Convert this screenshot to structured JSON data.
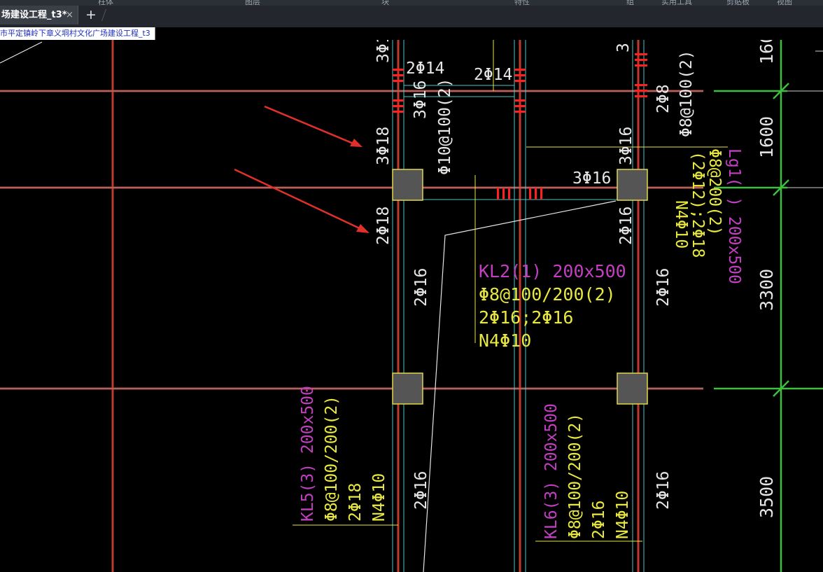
{
  "menu": {
    "items": [
      "柱体",
      "图层",
      "块",
      "特性",
      "组",
      "实用工具",
      "剪贴板",
      "视图"
    ]
  },
  "tabs": {
    "active_label": "场建设工程_t3*",
    "close_glyph": "×",
    "add_glyph": "+"
  },
  "filepath": "市平定镇岭下章义垌村文化广场建设工程_t3",
  "colors": {
    "axis_red": "#c0392b",
    "beam_cyan": "#4fc6c6",
    "rebar_white": "#e6e6e6",
    "beam_label_magenta": "#c040c0",
    "rebar_yellow": "#e8e840",
    "column_fill": "#555555",
    "column_border": "#e0d84a",
    "dim_green": "#3fbf3f",
    "arrow_red": "#e0302a"
  },
  "drawing": {
    "rebar_texts": {
      "col_left_top_cut": "3Φ1",
      "col_left_mid_top": "3Φ18",
      "col_left_mid_bottom": "2Φ18",
      "col_left_lower": "2Φ16",
      "col_left_bottom": "2Φ16",
      "beam_top_left": "2Φ14",
      "beam_top_right": "2Φ14",
      "beam_3Φ16_vertical": "3Φ16",
      "stirrup_vertical": "Φ10@100(2)",
      "col_right_top_cut": "3",
      "col_right_2Φ8": "2Φ8",
      "col_right_stirrup": "Φ8@100(2)",
      "col_right_3Φ16": "3Φ16",
      "beam_mid_3Φ16": "3Φ16",
      "col_right_2Φ16": "2Φ16",
      "col_right_lower": "2Φ16",
      "col_right_bottom": "2Φ16"
    },
    "kl2": {
      "title": "KL2(1) 200x500",
      "stirrup": "Φ8@100/200(2)",
      "bars": "2Φ16;2Φ16",
      "waist": "N4Φ10"
    },
    "lg1": {
      "title": "Lg1( ) 200x500",
      "stirrup": "Φ8@200(2)",
      "bars": "(2Φ12);2Φ18",
      "waist": "N4Φ10"
    },
    "kl5": {
      "title": "KL5(3) 200x500",
      "stirrup": "Φ8@100/200(2)",
      "bars": "2Φ18",
      "waist": "N4Φ10"
    },
    "kl6": {
      "title": "KL6(3) 200x500",
      "stirrup": "Φ8@100/200(2)",
      "bars": "2Φ16",
      "waist": "N4Φ10"
    },
    "dimensions": {
      "d_top_cut": "160",
      "d1": "1600",
      "d2": "3300",
      "d3": "3500"
    }
  }
}
